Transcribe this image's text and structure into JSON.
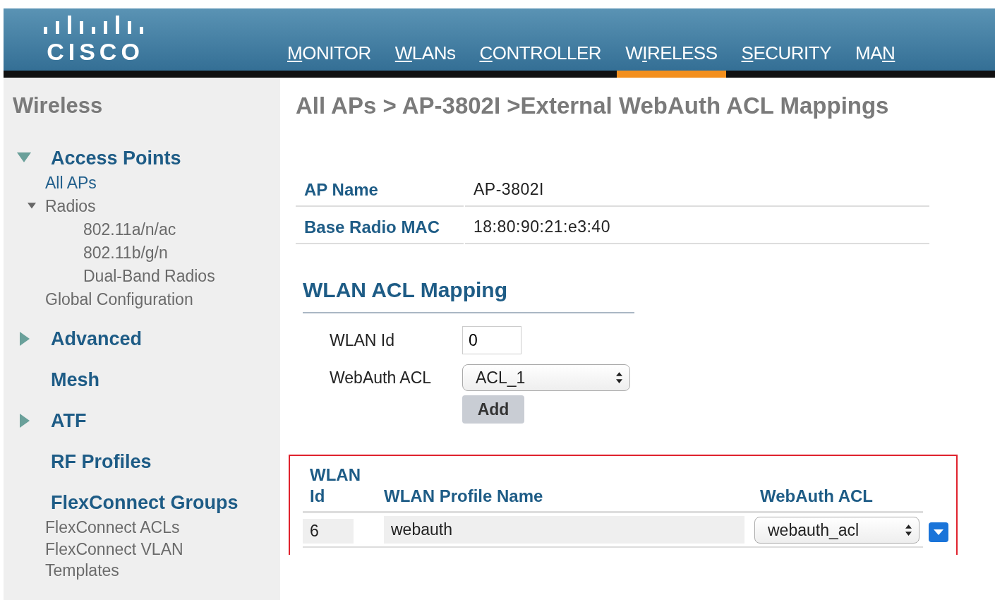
{
  "header": {
    "logo": "CISCO",
    "nav": [
      {
        "key": "M",
        "post": "ONITOR",
        "selected": false
      },
      {
        "key": "W",
        "post": "LANs",
        "selected": false
      },
      {
        "key": "C",
        "post": "ONTROLLER",
        "selected": false
      },
      {
        "pre": "W",
        "key": "I",
        "post": "RELESS",
        "selected": true
      },
      {
        "key": "S",
        "post": "ECURITY",
        "selected": false
      },
      {
        "pre": "MA",
        "key": "N",
        "selected": false
      }
    ]
  },
  "sidebar": {
    "title": "Wireless",
    "sections": [
      {
        "label": "Access Points",
        "kind": "expandable",
        "expanded": true,
        "children": [
          {
            "label": "All APs",
            "selected": true
          },
          {
            "label": "Radios",
            "selected": false,
            "expanded": true,
            "children": [
              {
                "label": "802.11a/n/ac",
                "selected": false
              },
              {
                "label": "802.11b/g/n",
                "selected": false
              },
              {
                "label": "Dual-Band Radios",
                "selected": false
              }
            ]
          },
          {
            "label": "Global Configuration",
            "selected": false
          }
        ]
      },
      {
        "label": "Advanced",
        "kind": "expandable",
        "expanded": false
      },
      {
        "label": "Mesh",
        "kind": "plain"
      },
      {
        "label": "ATF",
        "kind": "expandable",
        "expanded": false
      },
      {
        "label": "RF Profiles",
        "kind": "plain"
      },
      {
        "label": "FlexConnect Groups",
        "kind": "plain",
        "children": [
          {
            "label": "FlexConnect ACLs",
            "selected": false
          },
          {
            "label": "FlexConnect VLAN Templates",
            "selected": false
          }
        ]
      }
    ]
  },
  "page_title": "All APs > AP-3802I >External WebAuth ACL Mappings",
  "ap_info": [
    {
      "label": "AP Name",
      "value": "AP-3802I"
    },
    {
      "label": "Base Radio MAC",
      "value": "18:80:90:21:e3:40"
    }
  ],
  "mapping": {
    "heading": "WLAN ACL Mapping",
    "wlan_id": {
      "label": "WLAN Id",
      "value": "0"
    },
    "webauth_acl": {
      "label": "WebAuth ACL",
      "value": "ACL_1"
    },
    "add_button": "Add"
  },
  "table": {
    "highlighted": true,
    "columns": [
      "WLAN Id",
      "WLAN Profile Name",
      "WebAuth ACL"
    ],
    "rows": [
      {
        "wlan_id": "6",
        "profile": "webauth",
        "acl": "webauth_acl"
      }
    ]
  }
}
